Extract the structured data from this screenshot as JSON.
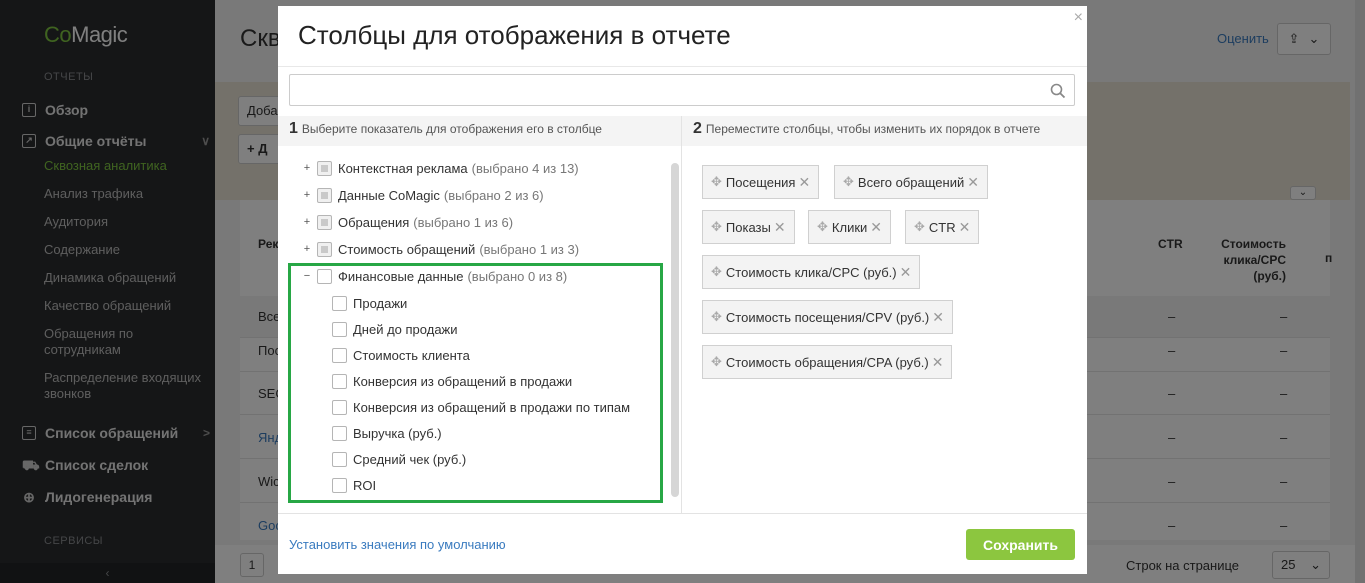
{
  "sidebar": {
    "logo_part1": "Co",
    "logo_part2": "Magic",
    "section_reports": "ОТЧЕТЫ",
    "section_services": "СЕРВИСЫ",
    "overview": "Обзор",
    "general_reports": "Общие отчёты",
    "sub_items": [
      "Сквозная аналитика",
      "Анализ трафика",
      "Аудитория",
      "Содержание",
      "Динамика обращений",
      "Качество обращений",
      "Обращения по сотрудникам",
      "Распределение входящих звонков"
    ],
    "calls_list": "Список обращений",
    "deals_list": "Список сделок",
    "leadgen": "Лидогенерация",
    "collapse_glyph": "‹"
  },
  "background": {
    "title_fragment": "Скв",
    "rate_link": "Оценить",
    "add_button": "Доба",
    "add2_button": "+ Д",
    "col_report": "Рек",
    "col_ctr": "CTR",
    "col_cpc": "Стоимость клика/CPC (руб.)",
    "col_trailing": "п",
    "rows": [
      {
        "label": "Всег",
        "c1": "–",
        "c2": "–"
      },
      {
        "label": "Пос",
        "c1": "–",
        "c2": "–"
      },
      {
        "label": "SEC",
        "c1": "–",
        "c2": "–"
      },
      {
        "label": "Янд",
        "c1": "–",
        "c2": "–"
      },
      {
        "label": "Wic",
        "c1": "–",
        "c2": "–"
      },
      {
        "label": "Goo",
        "c1": "–",
        "c2": "–"
      }
    ],
    "page_number": "1",
    "rows_per_page_label": "Строк на странице",
    "rows_per_page_value": "25"
  },
  "modal": {
    "title": "Столбцы для отображения в отчете",
    "close_glyph": "×",
    "search_placeholder": "",
    "left_head_num": "1",
    "left_head_text": "Выберите показатель для отображения его в столбце",
    "right_head_num": "2",
    "right_head_text": "Переместите столбцы, чтобы изменить их порядок в отчете",
    "groups": [
      {
        "label": "Контекстная реклама",
        "selected": "(выбрано 4 из 13)"
      },
      {
        "label": "Данные CoMagic",
        "selected": "(выбрано 2 из 6)"
      },
      {
        "label": "Обращения",
        "selected": "(выбрано 1 из 6)"
      },
      {
        "label": "Стоимость обращений",
        "selected": "(выбрано 1 из 3)"
      },
      {
        "label": "Финансовые данные",
        "selected": "(выбрано 0 из 8)"
      }
    ],
    "finance_items": [
      "Продажи",
      "Дней до продажи",
      "Стоимость клиента",
      "Конверсия из обращений в продажи",
      "Конверсия из обращений в продажи по типам",
      "Выручка (руб.)",
      "Средний чек (руб.)",
      "ROI"
    ],
    "selected_columns": [
      "Посещения",
      "Всего обращений",
      "Показы",
      "Клики",
      "CTR",
      "Стоимость клика/CPC (руб.)",
      "Стоимость посещения/CPV (руб.)",
      "Стоимость обращения/CPA (руб.)"
    ],
    "reset_link": "Установить значения по умолчанию",
    "save_button": "Сохранить"
  },
  "colors": {
    "accent_green": "#8cc63f",
    "highlight_green": "#27a745",
    "link_blue": "#3a7bbf",
    "sidebar_bg": "#2b2d2f"
  }
}
